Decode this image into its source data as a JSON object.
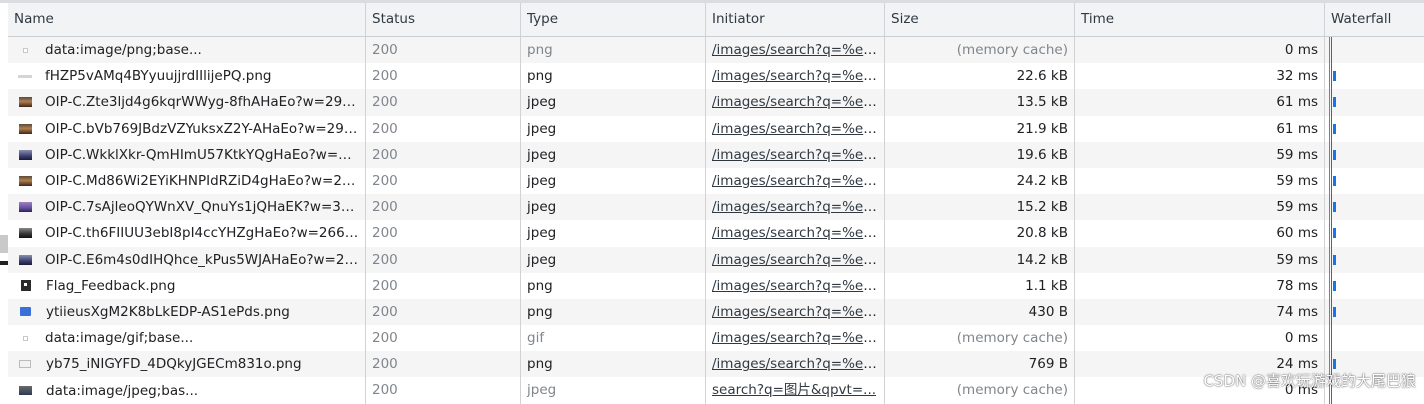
{
  "columns": [
    "Name",
    "Status",
    "Type",
    "Initiator",
    "Size",
    "Time",
    "Waterfall"
  ],
  "rows": [
    {
      "name": "data:image/png;base...",
      "icon": "data-dot-icon",
      "status": "200",
      "type": "png",
      "initiator": "/images/search?q=%e5...",
      "size": "(memory cache)",
      "time": "0 ms",
      "muted": true
    },
    {
      "name": "fHZP5vAMq4BYyuujjrdIIlijePQ.png",
      "icon": "thin-bar-icon",
      "status": "200",
      "type": "png",
      "initiator": "/images/search?q=%e5...",
      "size": "22.6 kB",
      "time": "32 ms",
      "muted": false
    },
    {
      "name": "OIP-C.Zte3ljd4g6kqrWWyg-8fhAHaEo?w=290...",
      "icon": "image-thumb-icon",
      "status": "200",
      "type": "jpeg",
      "initiator": "/images/search?q=%e5...",
      "size": "13.5 kB",
      "time": "61 ms",
      "muted": false
    },
    {
      "name": "OIP-C.bVb769JBdzVZYuksxZ2Y-AHaEo?w=290...",
      "icon": "image-thumb-icon",
      "status": "200",
      "type": "jpeg",
      "initiator": "/images/search?q=%e5...",
      "size": "21.9 kB",
      "time": "61 ms",
      "muted": false
    },
    {
      "name": "OIP-C.WkklXkr-QmHImU57KtkYQgHaEo?w=29...",
      "icon": "image-thumb-icon",
      "status": "200",
      "type": "jpeg",
      "initiator": "/images/search?q=%e5...",
      "size": "19.6 kB",
      "time": "59 ms",
      "muted": false
    },
    {
      "name": "OIP-C.Md86Wi2EYiKHNPIdRZiD4gHaEo?w=29...",
      "icon": "image-thumb-icon",
      "status": "200",
      "type": "jpeg",
      "initiator": "/images/search?q=%e5...",
      "size": "24.2 kB",
      "time": "59 ms",
      "muted": false
    },
    {
      "name": "OIP-C.7sAjleoQYWnXV_QnuYs1jQHaEK?w=323...",
      "icon": "image-thumb-icon",
      "status": "200",
      "type": "jpeg",
      "initiator": "/images/search?q=%e5...",
      "size": "15.2 kB",
      "time": "59 ms",
      "muted": false
    },
    {
      "name": "OIP-C.th6FIIUU3ebI8pI4ccYHZgHaEo?w=266&...",
      "icon": "image-thumb-icon",
      "status": "200",
      "type": "jpeg",
      "initiator": "/images/search?q=%e5...",
      "size": "20.8 kB",
      "time": "60 ms",
      "muted": false
    },
    {
      "name": "OIP-C.E6m4s0dIHQhce_kPus5WJAHaEo?w=26...",
      "icon": "image-thumb-icon",
      "status": "200",
      "type": "jpeg",
      "initiator": "/images/search?q=%e5...",
      "size": "14.2 kB",
      "time": "59 ms",
      "muted": false
    },
    {
      "name": "Flag_Feedback.png",
      "icon": "flag-icon",
      "status": "200",
      "type": "png",
      "initiator": "/images/search?q=%e5...",
      "size": "1.1 kB",
      "time": "78 ms",
      "muted": false
    },
    {
      "name": "ytiieusXgM2K8bLkEDP-AS1ePds.png",
      "icon": "chat-bubble-icon",
      "status": "200",
      "type": "png",
      "initiator": "/images/search?q=%e5...",
      "size": "430 B",
      "time": "74 ms",
      "muted": false
    },
    {
      "name": "data:image/gif;base...",
      "icon": "data-dot-icon",
      "status": "200",
      "type": "gif",
      "initiator": "/images/search?q=%e5...",
      "size": "(memory cache)",
      "time": "0 ms",
      "muted": true
    },
    {
      "name": "yb75_iNIGYFD_4DQkyJGECm831o.png",
      "icon": "tiny-image-icon",
      "status": "200",
      "type": "png",
      "initiator": "/images/search?q=%e5...",
      "size": "769 B",
      "time": "24 ms",
      "muted": false
    },
    {
      "name": "data:image/jpeg;bas...",
      "icon": "wide-image-icon",
      "status": "200",
      "type": "jpeg",
      "initiator": "search?q=图片&qpvt=...",
      "size": "(memory cache)",
      "time": "0 ms",
      "muted": true
    }
  ],
  "watermark": "CSDN @喜欢玩游戏的大尾巴狼"
}
